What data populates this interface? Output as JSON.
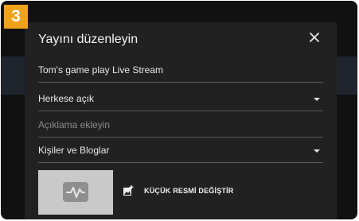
{
  "step": {
    "number": "3"
  },
  "dialog": {
    "title": "Yayını düzenleyin",
    "close_icon": "close-icon"
  },
  "fields": {
    "title_value": "Tom's game play Live Stream",
    "visibility_value": "Herkese açık",
    "description_placeholder": "Açıklama ekleyin",
    "category_value": "Kişiler ve Bloglar"
  },
  "thumbnail": {
    "icon": "pulse-waveform-icon",
    "change_icon": "add-image-icon",
    "change_label": "KÜÇÜK RESMİ DEĞİŞTİR"
  },
  "colors": {
    "badge": "#f0a31a",
    "dialog_bg": "#212121",
    "backdrop": "#111111",
    "thumbnail_bg": "#c9c9c9"
  }
}
